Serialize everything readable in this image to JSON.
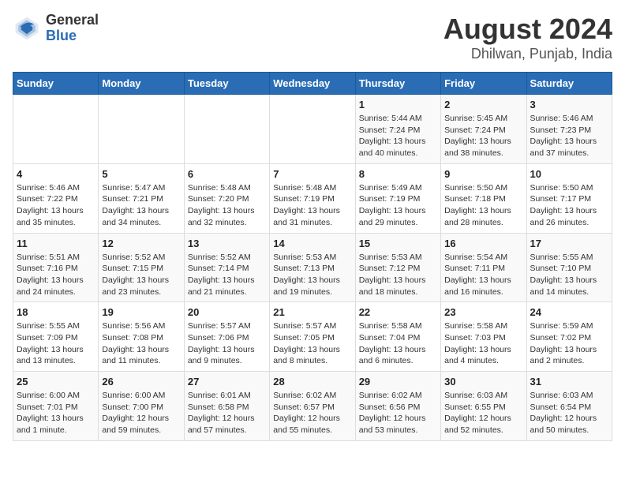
{
  "header": {
    "logo_general": "General",
    "logo_blue": "Blue",
    "title": "August 2024",
    "subtitle": "Dhilwan, Punjab, India"
  },
  "weekdays": [
    "Sunday",
    "Monday",
    "Tuesday",
    "Wednesday",
    "Thursday",
    "Friday",
    "Saturday"
  ],
  "weeks": [
    [
      {
        "day": "",
        "sunrise": "",
        "sunset": "",
        "daylight": ""
      },
      {
        "day": "",
        "sunrise": "",
        "sunset": "",
        "daylight": ""
      },
      {
        "day": "",
        "sunrise": "",
        "sunset": "",
        "daylight": ""
      },
      {
        "day": "",
        "sunrise": "",
        "sunset": "",
        "daylight": ""
      },
      {
        "day": "1",
        "sunrise": "Sunrise: 5:44 AM",
        "sunset": "Sunset: 7:24 PM",
        "daylight": "Daylight: 13 hours and 40 minutes."
      },
      {
        "day": "2",
        "sunrise": "Sunrise: 5:45 AM",
        "sunset": "Sunset: 7:24 PM",
        "daylight": "Daylight: 13 hours and 38 minutes."
      },
      {
        "day": "3",
        "sunrise": "Sunrise: 5:46 AM",
        "sunset": "Sunset: 7:23 PM",
        "daylight": "Daylight: 13 hours and 37 minutes."
      }
    ],
    [
      {
        "day": "4",
        "sunrise": "Sunrise: 5:46 AM",
        "sunset": "Sunset: 7:22 PM",
        "daylight": "Daylight: 13 hours and 35 minutes."
      },
      {
        "day": "5",
        "sunrise": "Sunrise: 5:47 AM",
        "sunset": "Sunset: 7:21 PM",
        "daylight": "Daylight: 13 hours and 34 minutes."
      },
      {
        "day": "6",
        "sunrise": "Sunrise: 5:48 AM",
        "sunset": "Sunset: 7:20 PM",
        "daylight": "Daylight: 13 hours and 32 minutes."
      },
      {
        "day": "7",
        "sunrise": "Sunrise: 5:48 AM",
        "sunset": "Sunset: 7:19 PM",
        "daylight": "Daylight: 13 hours and 31 minutes."
      },
      {
        "day": "8",
        "sunrise": "Sunrise: 5:49 AM",
        "sunset": "Sunset: 7:19 PM",
        "daylight": "Daylight: 13 hours and 29 minutes."
      },
      {
        "day": "9",
        "sunrise": "Sunrise: 5:50 AM",
        "sunset": "Sunset: 7:18 PM",
        "daylight": "Daylight: 13 hours and 28 minutes."
      },
      {
        "day": "10",
        "sunrise": "Sunrise: 5:50 AM",
        "sunset": "Sunset: 7:17 PM",
        "daylight": "Daylight: 13 hours and 26 minutes."
      }
    ],
    [
      {
        "day": "11",
        "sunrise": "Sunrise: 5:51 AM",
        "sunset": "Sunset: 7:16 PM",
        "daylight": "Daylight: 13 hours and 24 minutes."
      },
      {
        "day": "12",
        "sunrise": "Sunrise: 5:52 AM",
        "sunset": "Sunset: 7:15 PM",
        "daylight": "Daylight: 13 hours and 23 minutes."
      },
      {
        "day": "13",
        "sunrise": "Sunrise: 5:52 AM",
        "sunset": "Sunset: 7:14 PM",
        "daylight": "Daylight: 13 hours and 21 minutes."
      },
      {
        "day": "14",
        "sunrise": "Sunrise: 5:53 AM",
        "sunset": "Sunset: 7:13 PM",
        "daylight": "Daylight: 13 hours and 19 minutes."
      },
      {
        "day": "15",
        "sunrise": "Sunrise: 5:53 AM",
        "sunset": "Sunset: 7:12 PM",
        "daylight": "Daylight: 13 hours and 18 minutes."
      },
      {
        "day": "16",
        "sunrise": "Sunrise: 5:54 AM",
        "sunset": "Sunset: 7:11 PM",
        "daylight": "Daylight: 13 hours and 16 minutes."
      },
      {
        "day": "17",
        "sunrise": "Sunrise: 5:55 AM",
        "sunset": "Sunset: 7:10 PM",
        "daylight": "Daylight: 13 hours and 14 minutes."
      }
    ],
    [
      {
        "day": "18",
        "sunrise": "Sunrise: 5:55 AM",
        "sunset": "Sunset: 7:09 PM",
        "daylight": "Daylight: 13 hours and 13 minutes."
      },
      {
        "day": "19",
        "sunrise": "Sunrise: 5:56 AM",
        "sunset": "Sunset: 7:08 PM",
        "daylight": "Daylight: 13 hours and 11 minutes."
      },
      {
        "day": "20",
        "sunrise": "Sunrise: 5:57 AM",
        "sunset": "Sunset: 7:06 PM",
        "daylight": "Daylight: 13 hours and 9 minutes."
      },
      {
        "day": "21",
        "sunrise": "Sunrise: 5:57 AM",
        "sunset": "Sunset: 7:05 PM",
        "daylight": "Daylight: 13 hours and 8 minutes."
      },
      {
        "day": "22",
        "sunrise": "Sunrise: 5:58 AM",
        "sunset": "Sunset: 7:04 PM",
        "daylight": "Daylight: 13 hours and 6 minutes."
      },
      {
        "day": "23",
        "sunrise": "Sunrise: 5:58 AM",
        "sunset": "Sunset: 7:03 PM",
        "daylight": "Daylight: 13 hours and 4 minutes."
      },
      {
        "day": "24",
        "sunrise": "Sunrise: 5:59 AM",
        "sunset": "Sunset: 7:02 PM",
        "daylight": "Daylight: 13 hours and 2 minutes."
      }
    ],
    [
      {
        "day": "25",
        "sunrise": "Sunrise: 6:00 AM",
        "sunset": "Sunset: 7:01 PM",
        "daylight": "Daylight: 13 hours and 1 minute."
      },
      {
        "day": "26",
        "sunrise": "Sunrise: 6:00 AM",
        "sunset": "Sunset: 7:00 PM",
        "daylight": "Daylight: 12 hours and 59 minutes."
      },
      {
        "day": "27",
        "sunrise": "Sunrise: 6:01 AM",
        "sunset": "Sunset: 6:58 PM",
        "daylight": "Daylight: 12 hours and 57 minutes."
      },
      {
        "day": "28",
        "sunrise": "Sunrise: 6:02 AM",
        "sunset": "Sunset: 6:57 PM",
        "daylight": "Daylight: 12 hours and 55 minutes."
      },
      {
        "day": "29",
        "sunrise": "Sunrise: 6:02 AM",
        "sunset": "Sunset: 6:56 PM",
        "daylight": "Daylight: 12 hours and 53 minutes."
      },
      {
        "day": "30",
        "sunrise": "Sunrise: 6:03 AM",
        "sunset": "Sunset: 6:55 PM",
        "daylight": "Daylight: 12 hours and 52 minutes."
      },
      {
        "day": "31",
        "sunrise": "Sunrise: 6:03 AM",
        "sunset": "Sunset: 6:54 PM",
        "daylight": "Daylight: 12 hours and 50 minutes."
      }
    ]
  ]
}
